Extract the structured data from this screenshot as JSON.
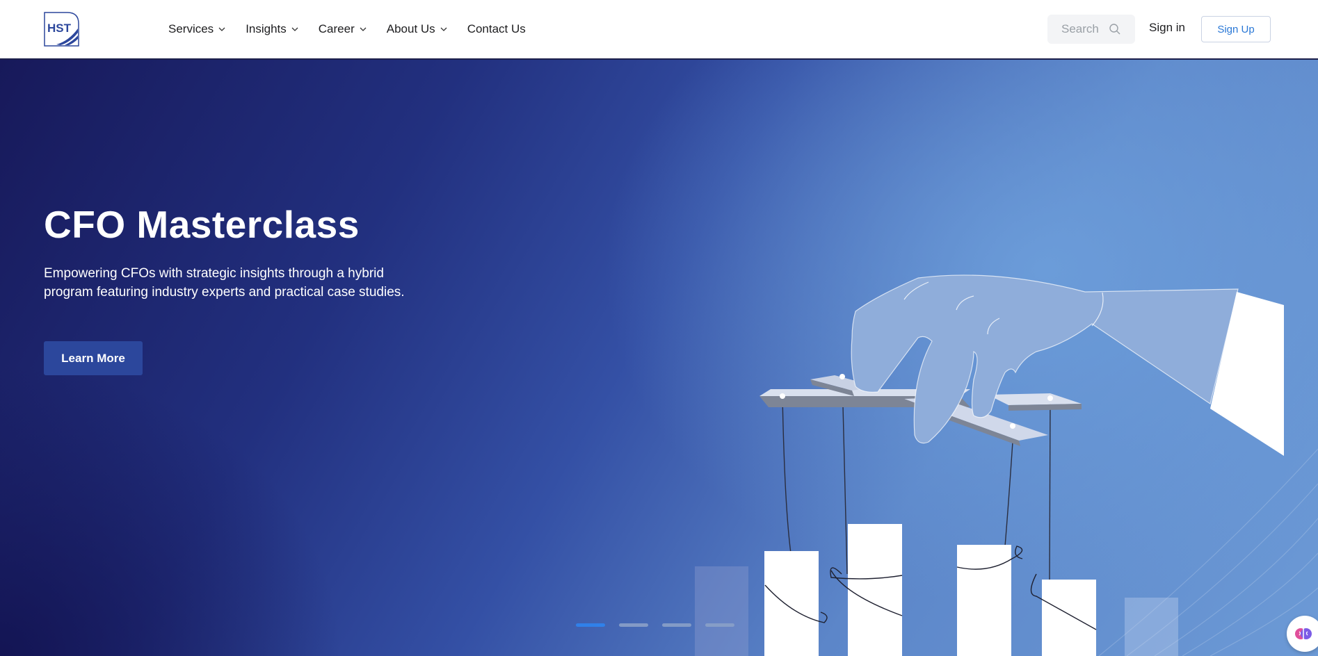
{
  "header": {
    "logo_text": "HST",
    "nav": [
      {
        "label": "Services",
        "icon": "chevron-down-icon"
      },
      {
        "label": "Insights",
        "icon": "chevron-down-icon"
      },
      {
        "label": "Career",
        "icon": "chevron-down-icon"
      },
      {
        "label": "About Us",
        "icon": "chevron-down-icon"
      },
      {
        "label": "Contact Us"
      }
    ],
    "search_placeholder": "Search",
    "sign_in": "Sign in",
    "sign_up": "Sign Up"
  },
  "hero": {
    "title": "CFO Masterclass",
    "description": "Empowering CFOs with strategic insights through a hybrid program featuring industry experts and practical case studies.",
    "cta": "Learn More",
    "illustration": "hand-puppeteering-bar-chart",
    "carousel": {
      "slides": 4,
      "active": 1
    }
  },
  "colors": {
    "brand_blue": "#2c479c",
    "accent_blue": "#2f84f0",
    "signup_text": "#2a78d6",
    "header_border": "#1c1f4a"
  }
}
